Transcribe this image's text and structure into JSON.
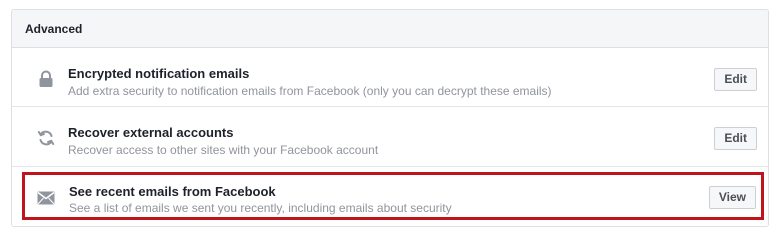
{
  "section": {
    "title": "Advanced"
  },
  "rows": [
    {
      "icon": "lock-icon",
      "title": "Encrypted notification emails",
      "description": "Add extra security to notification emails from Facebook (only you can decrypt these emails)",
      "button": "Edit"
    },
    {
      "icon": "refresh-icon",
      "title": "Recover external accounts",
      "description": "Recover access to other sites with your Facebook account",
      "button": "Edit"
    },
    {
      "icon": "envelope-icon",
      "title": "See recent emails from Facebook",
      "description": "See a list of emails we sent you recently, including emails about security",
      "button": "View",
      "highlighted": true
    }
  ],
  "colors": {
    "highlight": "#c0141c",
    "header_bg": "#f5f6f7",
    "icon": "#90949c"
  }
}
